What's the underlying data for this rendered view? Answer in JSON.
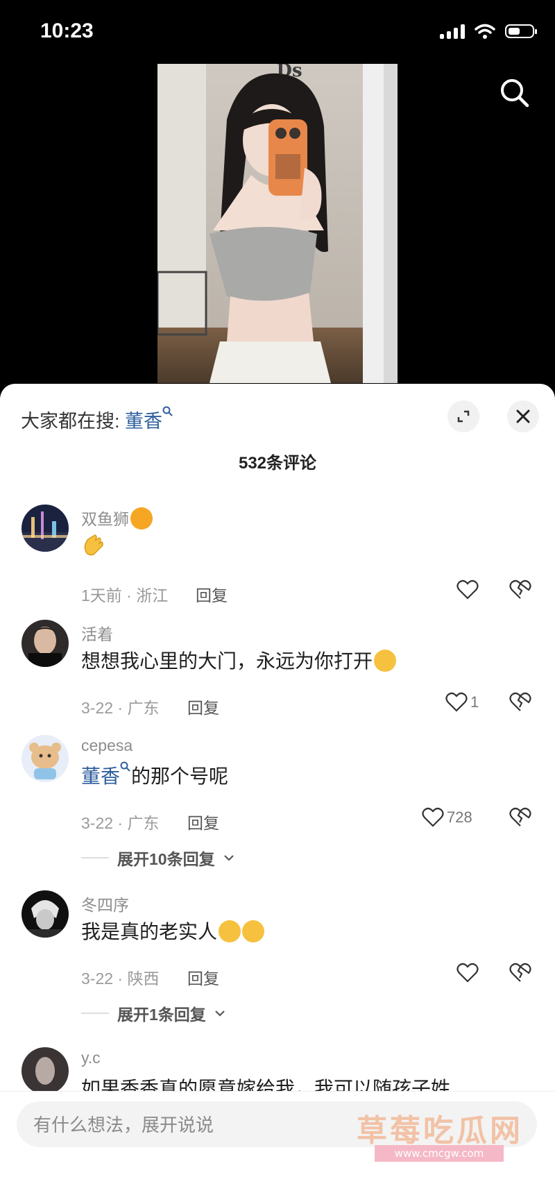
{
  "status_bar": {
    "time": "10:23",
    "battery_level": 0.5
  },
  "sheet": {
    "hot_search_prefix": "大家都在搜:",
    "hot_search_term": "董香",
    "comment_count": "532条评论"
  },
  "comments": [
    {
      "user": "双鱼狮",
      "text": "",
      "meta": "1天前 · 浙江",
      "reply": "回复",
      "likes": ""
    },
    {
      "user": "活着",
      "text": "想想我心里的大门，永远为你打开",
      "meta": "3-22 · 广东",
      "reply": "回复",
      "likes": "1"
    },
    {
      "user": "cepesa",
      "text_link": "董香",
      "text": "的那个号呢",
      "meta": "3-22 · 广东",
      "reply": "回复",
      "likes": "728",
      "expand": "展开10条回复"
    },
    {
      "user": "冬四序",
      "text": "我是真的老实人",
      "meta": "3-22 · 陕西",
      "reply": "回复",
      "likes": "",
      "expand": "展开1条回复"
    },
    {
      "user": "y.c",
      "text": "如果香香真的愿意嫁给我，我可以随孩子姓"
    }
  ],
  "input": {
    "placeholder": "有什么想法，展开说说"
  },
  "watermark": {
    "text": "草莓吃瓜网",
    "url": "www.cmcgw.com"
  },
  "colors": {
    "link": "#2e5e9e",
    "watermark": "#f2c2a6"
  }
}
